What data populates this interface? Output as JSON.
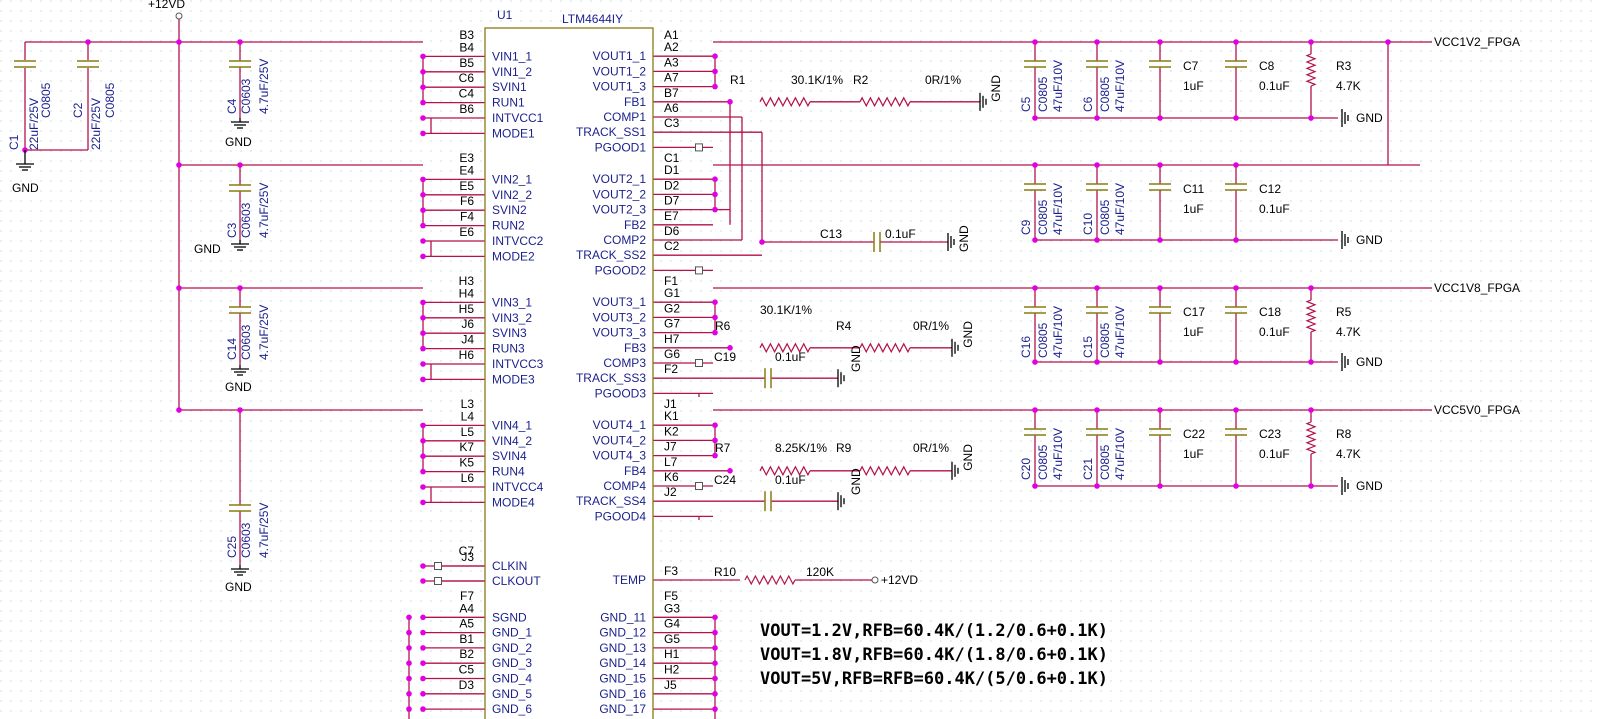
{
  "power_rail": "+12VD",
  "ic": {
    "ref": "U1",
    "part": "LTM4644IY",
    "left_pins": [
      {
        "num": "B3",
        "name": ""
      },
      {
        "num": "B4",
        "name": "VIN1_1"
      },
      {
        "num": "B5",
        "name": "VIN1_2"
      },
      {
        "num": "C6",
        "name": "SVIN1"
      },
      {
        "num": "C4",
        "name": "RUN1"
      },
      {
        "num": "B6",
        "name": "INTVCC1"
      },
      {
        "num": "",
        "name": "MODE1"
      },
      {
        "num": "E3",
        "name": ""
      },
      {
        "num": "E4",
        "name": "VIN2_1"
      },
      {
        "num": "E5",
        "name": "VIN2_2"
      },
      {
        "num": "F6",
        "name": "SVIN2"
      },
      {
        "num": "F4",
        "name": "RUN2"
      },
      {
        "num": "E6",
        "name": "INTVCC2"
      },
      {
        "num": "",
        "name": "MODE2"
      },
      {
        "num": "H3",
        "name": ""
      },
      {
        "num": "H4",
        "name": "VIN3_1"
      },
      {
        "num": "H5",
        "name": "VIN3_2"
      },
      {
        "num": "J6",
        "name": "SVIN3"
      },
      {
        "num": "J4",
        "name": "RUN3"
      },
      {
        "num": "H6",
        "name": "INTVCC3"
      },
      {
        "num": "",
        "name": "MODE3"
      },
      {
        "num": "L3",
        "name": ""
      },
      {
        "num": "L4",
        "name": "VIN4_1"
      },
      {
        "num": "L5",
        "name": "VIN4_2"
      },
      {
        "num": "K7",
        "name": "SVIN4"
      },
      {
        "num": "K5",
        "name": "RUN4"
      },
      {
        "num": "L6",
        "name": "INTVCC4"
      },
      {
        "num": "",
        "name": "MODE4"
      },
      {
        "num": "C7",
        "name": ""
      },
      {
        "num": "J3",
        "name": "CLKIN"
      },
      {
        "num": "",
        "name": "CLKOUT"
      },
      {
        "num": "F7",
        "name": ""
      },
      {
        "num": "A4",
        "name": "SGND"
      },
      {
        "num": "A5",
        "name": "GND_1"
      },
      {
        "num": "B1",
        "name": "GND_2"
      },
      {
        "num": "B2",
        "name": "GND_3"
      },
      {
        "num": "C5",
        "name": "GND_4"
      },
      {
        "num": "D3",
        "name": "GND_5"
      },
      {
        "num": "",
        "name": "GND_6"
      }
    ],
    "right_pins": [
      {
        "num": "A1",
        "name": ""
      },
      {
        "num": "A2",
        "name": "VOUT1_1"
      },
      {
        "num": "A3",
        "name": "VOUT1_2"
      },
      {
        "num": "A7",
        "name": "VOUT1_3"
      },
      {
        "num": "B7",
        "name": "FB1"
      },
      {
        "num": "A6",
        "name": "COMP1"
      },
      {
        "num": "C3",
        "name": "TRACK_SS1"
      },
      {
        "num": "",
        "name": "PGOOD1"
      },
      {
        "num": "C1",
        "name": ""
      },
      {
        "num": "D1",
        "name": "VOUT2_1"
      },
      {
        "num": "D2",
        "name": "VOUT2_2"
      },
      {
        "num": "D7",
        "name": "VOUT2_3"
      },
      {
        "num": "E7",
        "name": "FB2"
      },
      {
        "num": "D6",
        "name": "COMP2"
      },
      {
        "num": "C2",
        "name": "TRACK_SS2"
      },
      {
        "num": "",
        "name": "PGOOD2"
      },
      {
        "num": "F1",
        "name": ""
      },
      {
        "num": "G1",
        "name": "VOUT3_1"
      },
      {
        "num": "G2",
        "name": "VOUT3_2"
      },
      {
        "num": "G7",
        "name": "VOUT3_3"
      },
      {
        "num": "H7",
        "name": "FB3"
      },
      {
        "num": "G6",
        "name": "COMP3"
      },
      {
        "num": "F2",
        "name": "TRACK_SS3"
      },
      {
        "num": "",
        "name": "PGOOD3"
      },
      {
        "num": "J1",
        "name": ""
      },
      {
        "num": "K1",
        "name": "VOUT4_1"
      },
      {
        "num": "K2",
        "name": "VOUT4_2"
      },
      {
        "num": "J7",
        "name": "VOUT4_3"
      },
      {
        "num": "L7",
        "name": "FB4"
      },
      {
        "num": "K6",
        "name": "COMP4"
      },
      {
        "num": "J2",
        "name": "TRACK_SS4"
      },
      {
        "num": "",
        "name": "PGOOD4"
      },
      {
        "num": "F3",
        "name": "TEMP"
      },
      {
        "num": "F5",
        "name": ""
      },
      {
        "num": "G3",
        "name": "GND_11"
      },
      {
        "num": "G4",
        "name": "GND_12"
      },
      {
        "num": "G5",
        "name": "GND_13"
      },
      {
        "num": "H1",
        "name": "GND_14"
      },
      {
        "num": "H2",
        "name": "GND_15"
      },
      {
        "num": "J5",
        "name": "GND_16"
      },
      {
        "num": "",
        "name": "GND_17"
      }
    ]
  },
  "input_caps": [
    {
      "ref": "C1",
      "pkg": "C0805",
      "val": "22uF/25V"
    },
    {
      "ref": "C2",
      "pkg": "C0805",
      "val": "22uF/25V"
    },
    {
      "ref": "C4",
      "pkg": "C0603",
      "val": "4.7uF/25V"
    },
    {
      "ref": "C3",
      "pkg": "C0603",
      "val": "4.7uF/25V"
    },
    {
      "ref": "C14",
      "pkg": "C0603",
      "val": "4.7uF/25V"
    },
    {
      "ref": "C25",
      "pkg": "C0603",
      "val": "4.7uF/25V"
    }
  ],
  "gnd_label": "GND",
  "rails": [
    {
      "name": "VCC1V2_FPGA"
    },
    {
      "name": "VCC1V8_FPGA"
    },
    {
      "name": "VCC5V0_FPGA"
    }
  ],
  "fb_resistors": [
    {
      "ref1": "R1",
      "val1": "30.1K/1%",
      "ref2": "R2",
      "val2": "0R/1%"
    },
    {
      "ref1": "R6",
      "val1": "30.1K/1%",
      "ref2": "R4",
      "val2": "0R/1%"
    },
    {
      "ref1": "R7",
      "val1": "8.25K/1%",
      "ref2": "R9",
      "val2": "0R/1%"
    }
  ],
  "ss_caps": [
    {
      "ref": "C13",
      "val": "0.1uF"
    },
    {
      "ref": "C19",
      "val": "0.1uF"
    },
    {
      "ref": "C24",
      "val": "0.1uF"
    }
  ],
  "output_groups": [
    {
      "c1": "C5",
      "c2": "C6",
      "c3": "C7",
      "c4": "C8",
      "r": "R3",
      "rval": "4.7K"
    },
    {
      "c1": "C9",
      "c2": "C10",
      "c3": "C11",
      "c4": "C12",
      "r": "",
      "rval": ""
    },
    {
      "c1": "C16",
      "c2": "C15",
      "c3": "C17",
      "c4": "C18",
      "r": "R5",
      "rval": "4.7K"
    },
    {
      "c1": "C20",
      "c2": "C21",
      "c3": "C22",
      "c4": "C23",
      "r": "R8",
      "rval": "4.7K"
    }
  ],
  "out_cap_pkg": "C0805",
  "out_cap_val": "47uF/10V",
  "cap_1u": "1uF",
  "cap_01u": "0.1uF",
  "temp": {
    "ref": "R10",
    "val": "120K",
    "rail": "+12VD"
  },
  "equations": [
    "VOUT=1.2V,RFB=60.4K/(1.2/0.6+0.1K)",
    "VOUT=1.8V,RFB=60.4K/(1.8/0.6+0.1K)",
    "VOUT=5V,RFB=RFB=60.4K/(5/0.6+0.1K)"
  ]
}
